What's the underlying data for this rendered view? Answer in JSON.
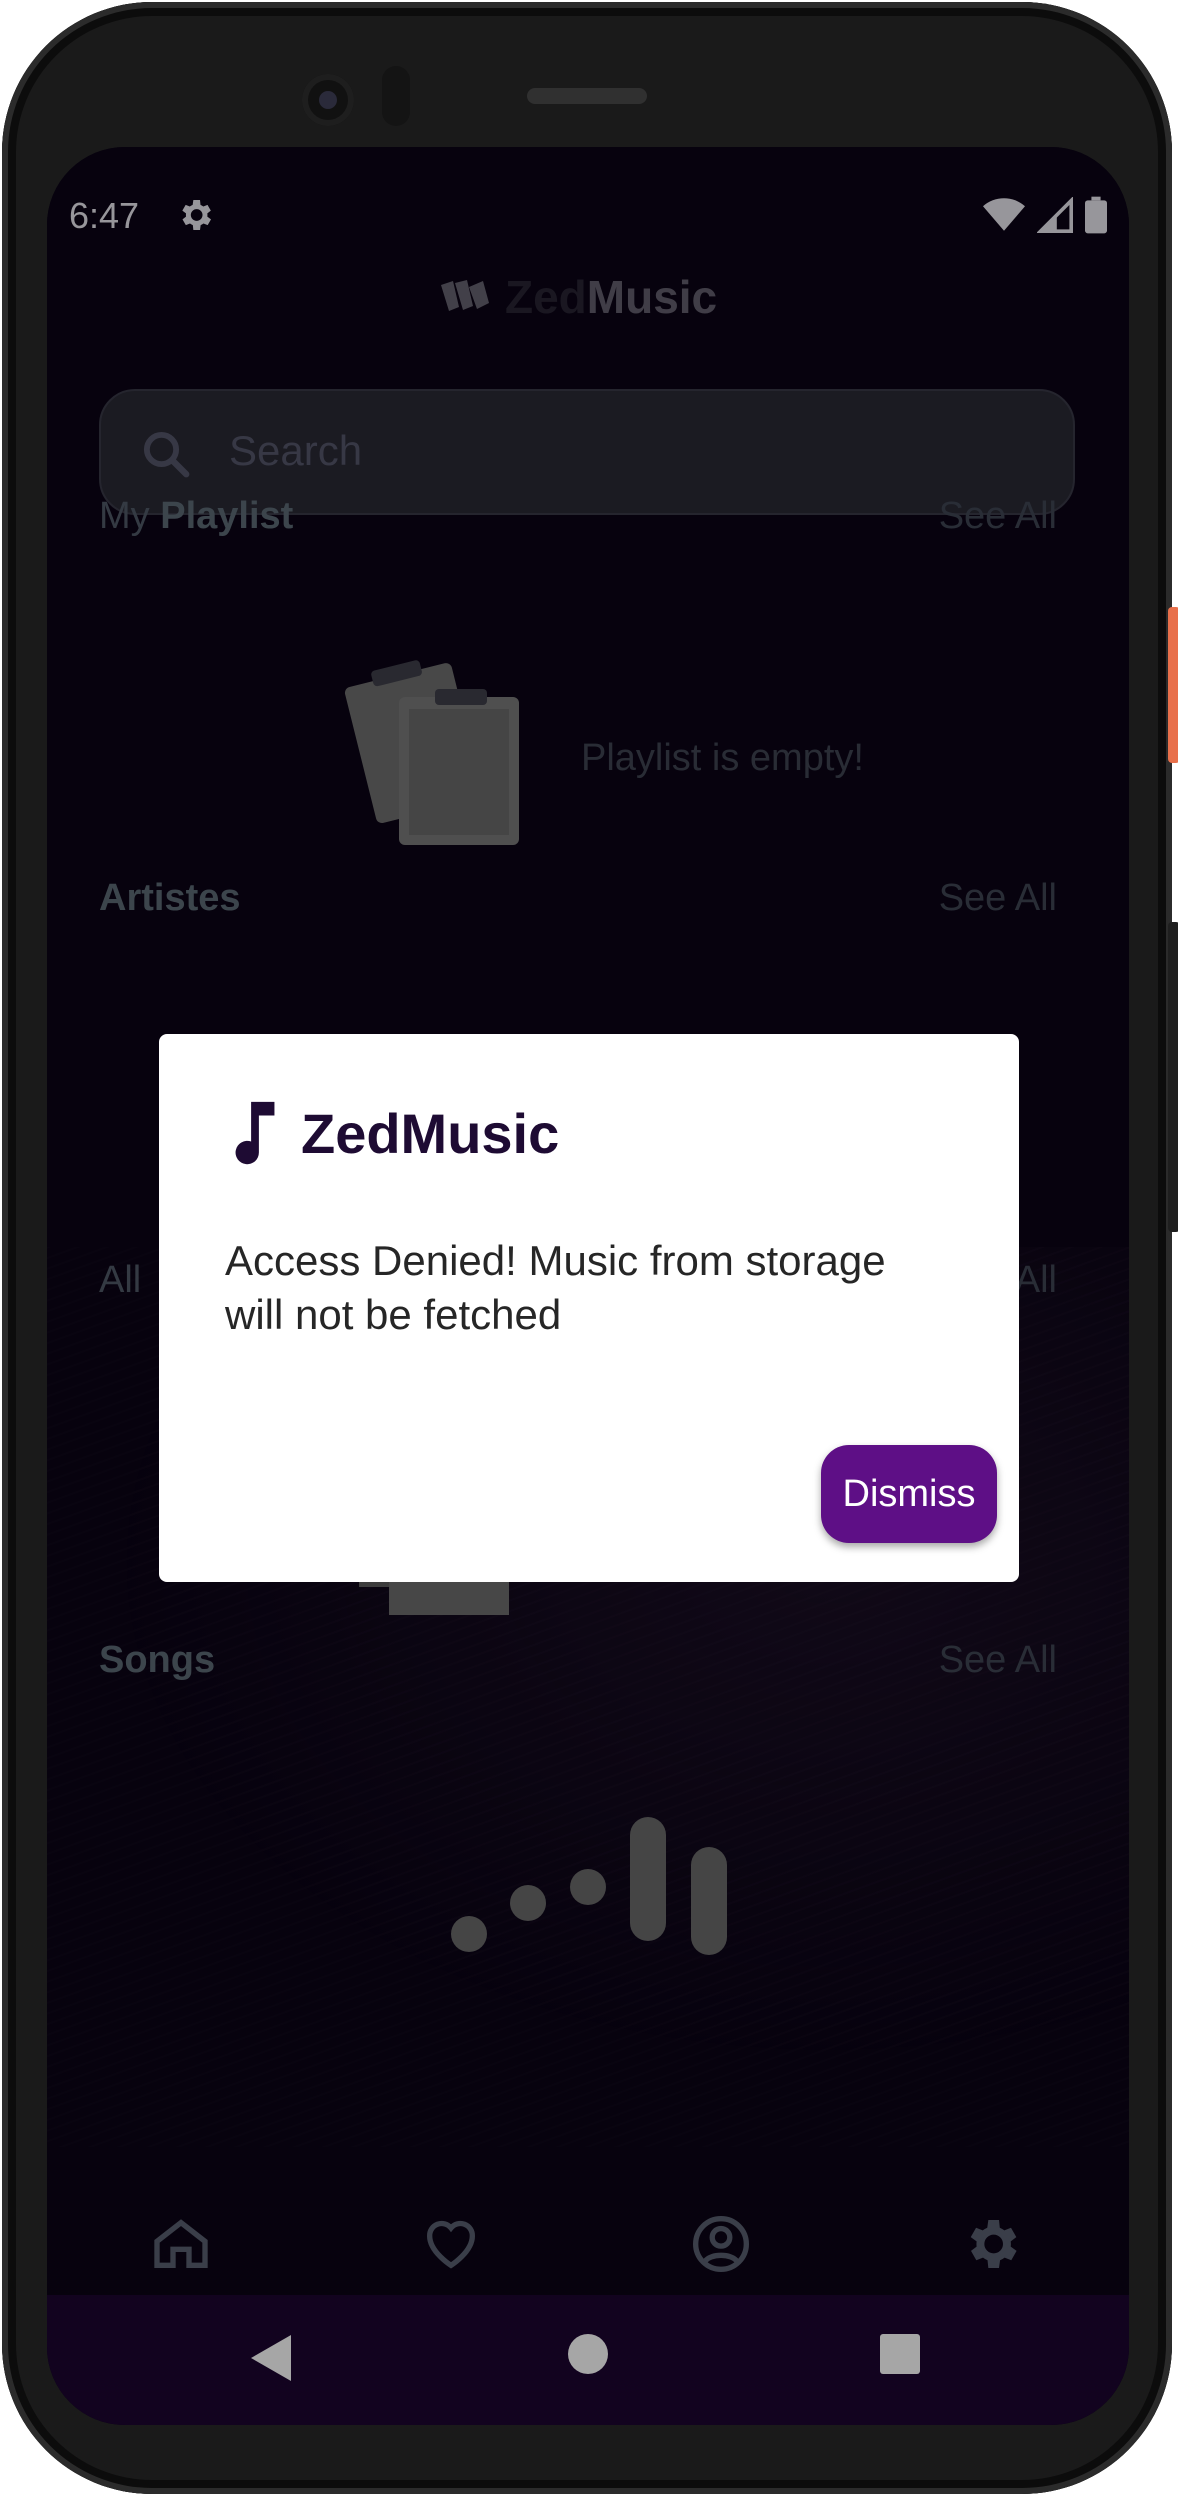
{
  "status_bar": {
    "time": "6:47"
  },
  "app": {
    "name_prefix": "Zed",
    "name_suffix": "Music",
    "search": {
      "placeholder": "Search"
    },
    "sections": {
      "playlist": {
        "prefix": "My",
        "title": "Playlist",
        "see_all": "See All",
        "empty_message": "Playlist is empty!"
      },
      "artistes": {
        "title": "Artistes",
        "see_all": "See All"
      },
      "all": {
        "prefix": "All",
        "see_all": "All"
      },
      "songs": {
        "title": "Songs",
        "see_all": "See All"
      }
    },
    "bottom_nav": [
      "home-icon",
      "heart-icon",
      "profile-icon",
      "settings-icon"
    ]
  },
  "dialog": {
    "title": "ZedMusic",
    "message": "Access Denied! Music from storage will not be fetched",
    "dismiss_label": "Dismiss"
  },
  "colors": {
    "background": "#0b0416",
    "accent": "#5e0f86",
    "system_nav": "#1c0530",
    "dialog_title": "#1e0b33"
  }
}
